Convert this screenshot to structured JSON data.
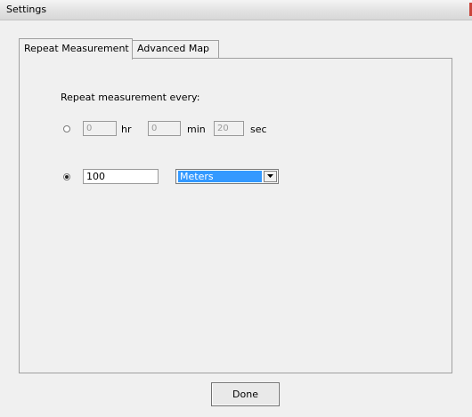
{
  "window": {
    "title": "Settings"
  },
  "tabs": [
    {
      "label": "Repeat Measurement",
      "active": true
    },
    {
      "label": "Advanced Map",
      "active": false
    }
  ],
  "repeat": {
    "heading": "Repeat measurement every:",
    "time_option": {
      "selected": false,
      "hours": "0",
      "hours_unit": "hr",
      "minutes": "0",
      "minutes_unit": "min",
      "seconds": "20",
      "seconds_unit": "sec"
    },
    "distance_option": {
      "selected": true,
      "value": "100",
      "unit": "Meters"
    }
  },
  "buttons": {
    "done": "Done"
  },
  "colors": {
    "selection": "#3399ff",
    "panel": "#f0f0f0"
  }
}
